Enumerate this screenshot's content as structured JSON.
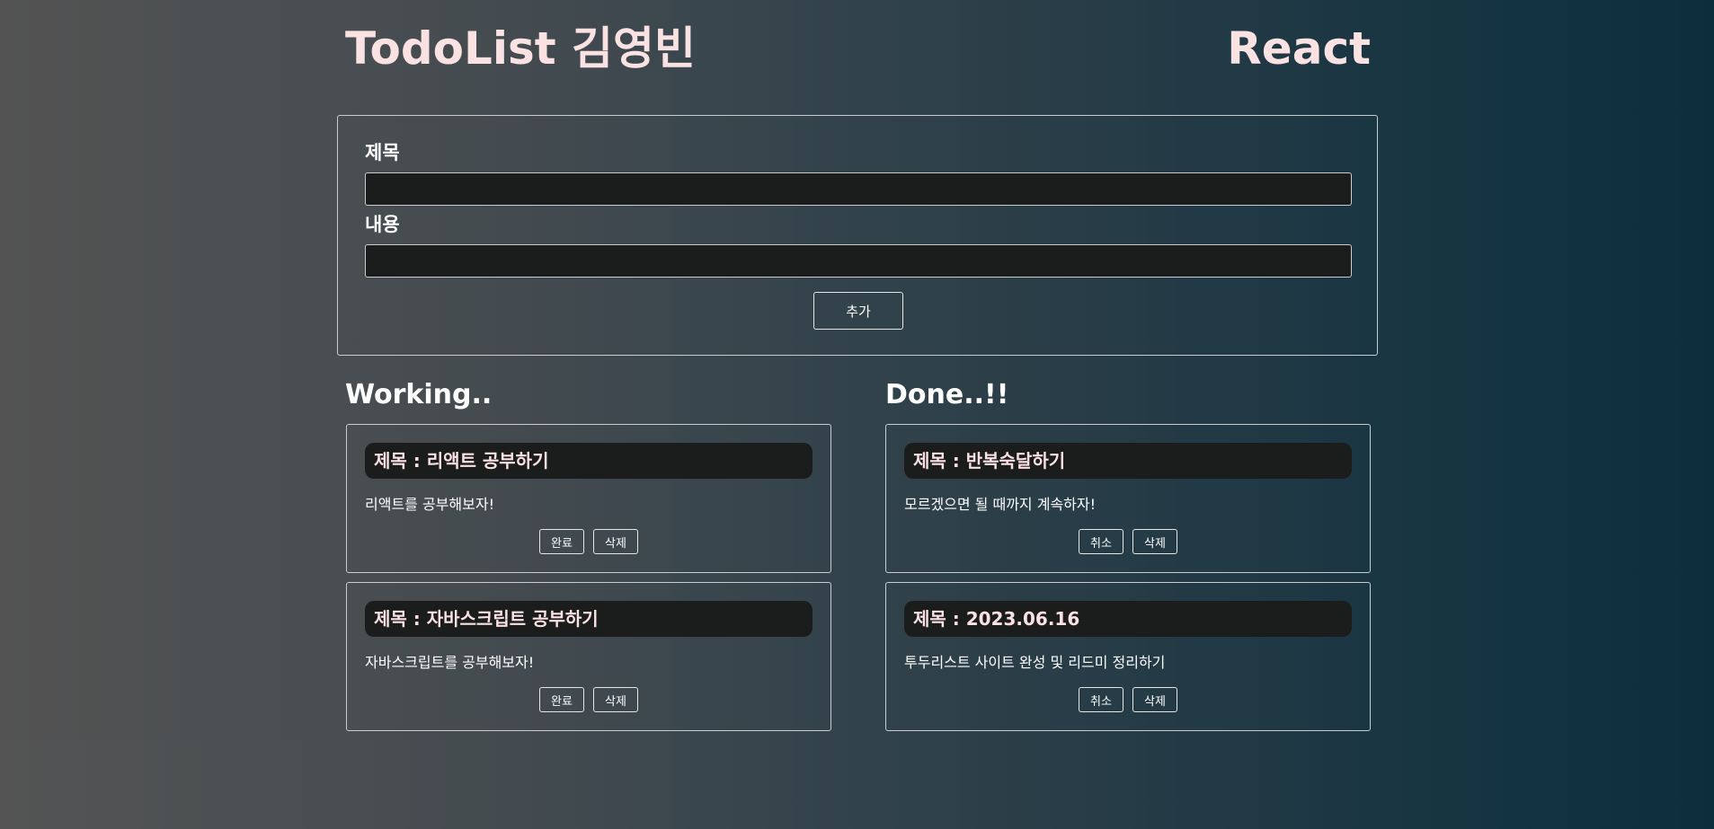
{
  "header": {
    "title": "TodoList 김영빈",
    "framework": "React"
  },
  "form": {
    "title_label": "제목",
    "title_value": "",
    "content_label": "내용",
    "content_value": "",
    "add_button": "추가"
  },
  "working": {
    "heading": "Working..",
    "items": [
      {
        "title": "제목 : 리액트 공부하기",
        "content": "리액트를 공부해보자!",
        "primary_button": "완료",
        "delete_button": "삭제"
      },
      {
        "title": "제목 : 자바스크립트 공부하기",
        "content": "자바스크립트를 공부해보자!",
        "primary_button": "완료",
        "delete_button": "삭제"
      }
    ]
  },
  "done": {
    "heading": "Done..!!",
    "items": [
      {
        "title": "제목 : 반복숙달하기",
        "content": "모르겠으면 될 때까지 계속하자!",
        "primary_button": "취소",
        "delete_button": "삭제"
      },
      {
        "title": "제목 : 2023.06.16",
        "content": "투두리스트 사이트 완성 및 리드미 정리하기",
        "primary_button": "취소",
        "delete_button": "삭제"
      }
    ]
  },
  "colors": {
    "title_pink": "#f9e2e1",
    "input_bg": "#1b1d1d",
    "border": "#c9cdd0"
  }
}
